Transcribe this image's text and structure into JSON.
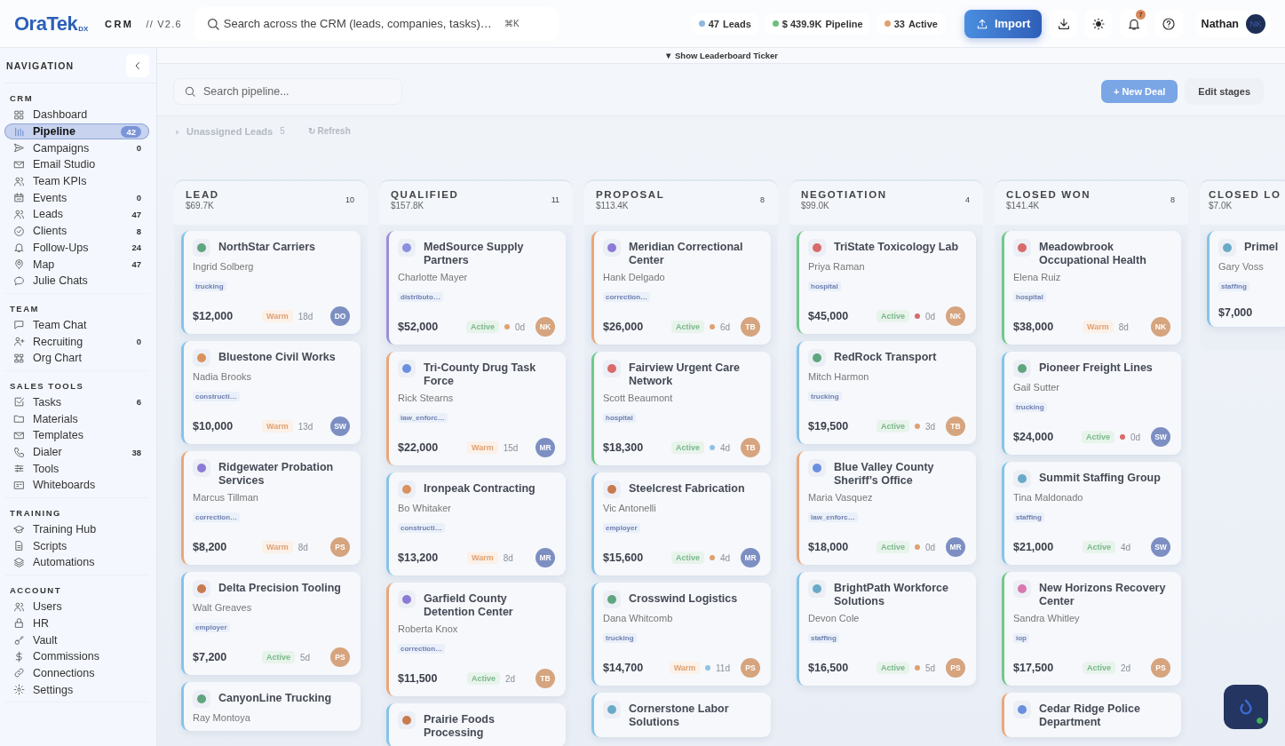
{
  "topbar": {
    "logo": "OraTek",
    "logo_suffix": "DX",
    "product": "CRM",
    "version": "// V2.6",
    "search": {
      "placeholder": "Search across the CRM (leads, companies, tasks)…",
      "shortcut": "⌘K"
    },
    "stats": [
      {
        "value": "47",
        "label": "Leads",
        "color": "#8fb8e0"
      },
      {
        "value": "$ 439.9K",
        "label": "Pipeline",
        "color": "#6cbf7c"
      },
      {
        "value": "33",
        "label": "Active",
        "color": "#e0a070"
      }
    ],
    "import_button": "Import",
    "notifications": "7",
    "user": {
      "name": "Nathan",
      "initials": "NK"
    }
  },
  "sidebar": {
    "title": "NAVIGATION",
    "sections": [
      {
        "title": "CRM",
        "items": [
          {
            "label": "Dashboard",
            "selected": false
          },
          {
            "label": "Pipeline",
            "count": "42",
            "selected": true
          },
          {
            "label": "Campaigns",
            "count": "0",
            "selected": false
          },
          {
            "label": "Email Studio",
            "selected": false
          },
          {
            "label": "Team KPIs",
            "selected": false
          },
          {
            "label": "Events",
            "count": "0",
            "selected": false
          },
          {
            "label": "Leads",
            "count": "47",
            "selected": false
          },
          {
            "label": "Clients",
            "count": "8",
            "selected": false
          },
          {
            "label": "Follow-Ups",
            "count": "24",
            "selected": false
          },
          {
            "label": "Map",
            "count": "47",
            "selected": false
          },
          {
            "label": "Julie Chats",
            "selected": false
          }
        ]
      },
      {
        "title": "TEAM",
        "items": [
          {
            "label": "Team Chat",
            "selected": false
          },
          {
            "label": "Recruiting",
            "count": "0",
            "selected": false
          },
          {
            "label": "Org Chart",
            "selected": false
          }
        ]
      },
      {
        "title": "SALES TOOLS",
        "items": [
          {
            "label": "Tasks",
            "count": "6",
            "selected": false
          },
          {
            "label": "Materials",
            "selected": false
          },
          {
            "label": "Templates",
            "selected": false
          },
          {
            "label": "Dialer",
            "count": "38",
            "selected": false
          },
          {
            "label": "Tools",
            "selected": false
          },
          {
            "label": "Whiteboards",
            "selected": false
          }
        ]
      },
      {
        "title": "TRAINING",
        "items": [
          {
            "label": "Training Hub",
            "selected": false
          },
          {
            "label": "Scripts",
            "selected": false
          },
          {
            "label": "Automations",
            "selected": false
          }
        ]
      },
      {
        "title": "ACCOUNT",
        "items": [
          {
            "label": "Users",
            "selected": false
          },
          {
            "label": "HR",
            "selected": false
          },
          {
            "label": "Vault",
            "selected": false
          },
          {
            "label": "Commissions",
            "selected": false
          },
          {
            "label": "Connections",
            "selected": false
          },
          {
            "label": "Settings",
            "selected": false
          }
        ]
      }
    ]
  },
  "ticker_toggle": "▼ Show Leaderboard Ticker",
  "toolbar": {
    "search": {
      "placeholder": "Search pipeline..."
    },
    "new_deal": "+ New Deal",
    "edit_stages": "Edit stages"
  },
  "unassigned": {
    "label": "Unassigned Leads",
    "count": "5",
    "refresh": "↻ Refresh"
  },
  "stages": [
    {
      "title": "LEAD",
      "total": "$69.7K",
      "count": "10",
      "deals": [
        {
          "company": "NorthStar Carriers",
          "contact": "Ingrid Solberg",
          "tag": "trucking",
          "amount": "$12,000",
          "status": {
            "label": "Warm",
            "kind": "warm"
          },
          "age": "18d",
          "owner": {
            "initials": "DO",
            "color": "#7d8fc2"
          },
          "color": "#86c3e8",
          "icon": {
            "color": "#5fa57f"
          }
        },
        {
          "company": "Bluestone Civil Works",
          "contact": "Nadia Brooks",
          "tag": "constructi…",
          "amount": "$10,000",
          "status": {
            "label": "Warm",
            "kind": "warm"
          },
          "age": "13d",
          "owner": {
            "initials": "SW",
            "color": "#7d8fc2"
          },
          "color": "#86c3e8",
          "icon": {
            "color": "#d9925f"
          }
        },
        {
          "company": "Ridgewater Probation Services",
          "contact": "Marcus Tillman",
          "tag": "correction…",
          "amount": "$8,200",
          "status": {
            "label": "Warm",
            "kind": "warm"
          },
          "age": "8d",
          "owner": {
            "initials": "PS",
            "color": "#d6a47e"
          },
          "color": "#eaa77a",
          "icon": {
            "color": "#8c7bd6"
          }
        },
        {
          "company": "Delta Precision Tooling",
          "contact": "Walt Greaves",
          "tag": "employer",
          "amount": "$7,200",
          "status": {
            "label": "Active",
            "kind": "active"
          },
          "age": "5d",
          "owner": {
            "initials": "PS",
            "color": "#d6a47e"
          },
          "color": "#86c3e8",
          "icon": {
            "color": "#c97b50"
          }
        },
        {
          "company": "CanyonLine Trucking",
          "contact": "Ray Montoya",
          "color": "#86c3e8",
          "icon": {
            "color": "#5fa57f"
          }
        }
      ]
    },
    {
      "title": "QUALIFIED",
      "total": "$157.8K",
      "count": "11",
      "deals": [
        {
          "company": "MedSource Supply Partners",
          "contact": "Charlotte Mayer",
          "tag": "distributo…",
          "amount": "$52,000",
          "status": {
            "label": "Active",
            "kind": "active"
          },
          "activity": {
            "color": "#e0a070"
          },
          "age": "0d",
          "owner": {
            "initials": "NK",
            "color": "#d6a47e"
          },
          "color": "#9b8fd8",
          "icon": {
            "color": "#8a8fe0"
          }
        },
        {
          "company": "Tri-County Drug Task Force",
          "contact": "Rick Stearns",
          "tag": "law_enforc…",
          "amount": "$22,000",
          "status": {
            "label": "Warm",
            "kind": "warm"
          },
          "age": "15d",
          "owner": {
            "initials": "MR",
            "color": "#7d8fc2"
          },
          "color": "#eaa77a",
          "icon": {
            "color": "#6a8fe0"
          }
        },
        {
          "company": "Ironpeak Contracting",
          "contact": "Bo Whitaker",
          "tag": "constructi…",
          "amount": "$13,200",
          "status": {
            "label": "Warm",
            "kind": "warm"
          },
          "age": "8d",
          "owner": {
            "initials": "MR",
            "color": "#7d8fc2"
          },
          "color": "#86c3e8",
          "icon": {
            "color": "#d9925f"
          }
        },
        {
          "company": "Garfield County Detention Center",
          "contact": "Roberta Knox",
          "tag": "correction…",
          "amount": "$11,500",
          "status": {
            "label": "Active",
            "kind": "active"
          },
          "age": "2d",
          "owner": {
            "initials": "TB",
            "color": "#d6a47e"
          },
          "color": "#eaa77a",
          "icon": {
            "color": "#8c7bd6"
          }
        },
        {
          "company": "Prairie Foods Processing",
          "color": "#86c3e8",
          "icon": {
            "color": "#c97b50"
          }
        }
      ]
    },
    {
      "title": "PROPOSAL",
      "total": "$113.4K",
      "count": "8",
      "deals": [
        {
          "company": "Meridian Correctional Center",
          "contact": "Hank Delgado",
          "tag": "correction…",
          "amount": "$26,000",
          "status": {
            "label": "Active",
            "kind": "active"
          },
          "activity": {
            "color": "#e0a070"
          },
          "age": "6d",
          "owner": {
            "initials": "TB",
            "color": "#d6a47e"
          },
          "color": "#eaa77a",
          "icon": {
            "color": "#8c7bd6"
          }
        },
        {
          "company": "Fairview Urgent Care Network",
          "contact": "Scott Beaumont",
          "tag": "hospital",
          "amount": "$18,300",
          "status": {
            "label": "Active",
            "kind": "active"
          },
          "activity": {
            "color": "#8fc3e6"
          },
          "age": "4d",
          "owner": {
            "initials": "TB",
            "color": "#d6a47e"
          },
          "color": "#72c98a",
          "icon": {
            "color": "#d96a6a"
          }
        },
        {
          "company": "Steelcrest Fabrication",
          "contact": "Vic Antonelli",
          "tag": "employer",
          "amount": "$15,600",
          "status": {
            "label": "Active",
            "kind": "active"
          },
          "activity": {
            "color": "#e0a070"
          },
          "age": "4d",
          "owner": {
            "initials": "MR",
            "color": "#7d8fc2"
          },
          "color": "#86c3e8",
          "icon": {
            "color": "#c97b50"
          }
        },
        {
          "company": "Crosswind Logistics",
          "contact": "Dana Whitcomb",
          "tag": "trucking",
          "amount": "$14,700",
          "status": {
            "label": "Warm",
            "kind": "warm"
          },
          "activity": {
            "color": "#8fc3e6"
          },
          "age": "11d",
          "owner": {
            "initials": "PS",
            "color": "#d6a47e"
          },
          "color": "#86c3e8",
          "icon": {
            "color": "#5fa57f"
          }
        },
        {
          "company": "Cornerstone Labor Solutions",
          "color": "#86c3e8",
          "icon": {
            "color": "#6aaac8"
          }
        }
      ]
    },
    {
      "title": "NEGOTIATION",
      "total": "$99.0K",
      "count": "4",
      "deals": [
        {
          "company": "TriState Toxicology Lab",
          "contact": "Priya Raman",
          "tag": "hospital",
          "amount": "$45,000",
          "status": {
            "label": "Active",
            "kind": "active"
          },
          "activity": {
            "color": "#d96a6a"
          },
          "age": "0d",
          "owner": {
            "initials": "NK",
            "color": "#d6a47e"
          },
          "color": "#72c98a",
          "icon": {
            "color": "#d96a6a"
          }
        },
        {
          "company": "RedRock Transport",
          "contact": "Mitch Harmon",
          "tag": "trucking",
          "amount": "$19,500",
          "status": {
            "label": "Active",
            "kind": "active"
          },
          "activity": {
            "color": "#e0a070"
          },
          "age": "3d",
          "owner": {
            "initials": "TB",
            "color": "#d6a47e"
          },
          "color": "#86c3e8",
          "icon": {
            "color": "#5fa57f"
          }
        },
        {
          "company": "Blue Valley County Sheriff’s Office",
          "contact": "Maria Vasquez",
          "tag": "law_enforc…",
          "amount": "$18,000",
          "status": {
            "label": "Active",
            "kind": "active"
          },
          "activity": {
            "color": "#e0a070"
          },
          "age": "0d",
          "owner": {
            "initials": "MR",
            "color": "#7d8fc2"
          },
          "color": "#eaa77a",
          "icon": {
            "color": "#6a8fe0"
          }
        },
        {
          "company": "BrightPath Workforce Solutions",
          "contact": "Devon Cole",
          "tag": "staffing",
          "amount": "$16,500",
          "status": {
            "label": "Active",
            "kind": "active"
          },
          "activity": {
            "color": "#e0a070"
          },
          "age": "5d",
          "owner": {
            "initials": "PS",
            "color": "#d6a47e"
          },
          "color": "#86c3e8",
          "icon": {
            "color": "#6aaac8"
          }
        }
      ]
    },
    {
      "title": "CLOSED WON",
      "total": "$141.4K",
      "count": "8",
      "deals": [
        {
          "company": "Meadowbrook Occupational Health",
          "contact": "Elena Ruiz",
          "tag": "hospital",
          "amount": "$38,000",
          "status": {
            "label": "Warm",
            "kind": "warm"
          },
          "age": "8d",
          "owner": {
            "initials": "NK",
            "color": "#d6a47e"
          },
          "color": "#72c98a",
          "icon": {
            "color": "#d96a6a"
          }
        },
        {
          "company": "Pioneer Freight Lines",
          "contact": "Gail Sutter",
          "tag": "trucking",
          "amount": "$24,000",
          "status": {
            "label": "Active",
            "kind": "active"
          },
          "activity": {
            "color": "#d96a6a"
          },
          "age": "0d",
          "owner": {
            "initials": "SW",
            "color": "#7d8fc2"
          },
          "color": "#86c3e8",
          "icon": {
            "color": "#5fa57f"
          }
        },
        {
          "company": "Summit Staffing Group",
          "contact": "Tina Maldonado",
          "tag": "staffing",
          "amount": "$21,000",
          "status": {
            "label": "Active",
            "kind": "active"
          },
          "age": "4d",
          "owner": {
            "initials": "SW",
            "color": "#7d8fc2"
          },
          "color": "#86c3e8",
          "icon": {
            "color": "#6aaac8"
          }
        },
        {
          "company": "New Horizons Recovery Center",
          "contact": "Sandra Whitley",
          "tag": "iop",
          "amount": "$17,500",
          "status": {
            "label": "Active",
            "kind": "active"
          },
          "age": "2d",
          "owner": {
            "initials": "PS",
            "color": "#d6a47e"
          },
          "color": "#72c98a",
          "icon": {
            "color": "#d978b0"
          }
        },
        {
          "company": "Cedar Ridge Police Department",
          "color": "#eaa77a",
          "icon": {
            "color": "#6a8fe0"
          }
        }
      ]
    },
    {
      "title": "CLOSED LO",
      "total": "$7.0K",
      "deals": [
        {
          "company": "Primel",
          "contact": "Gary Voss",
          "tag": "staffing",
          "amount": "$7,000",
          "color": "#86c3e8",
          "icon": {
            "color": "#6aaac8"
          }
        }
      ]
    }
  ]
}
